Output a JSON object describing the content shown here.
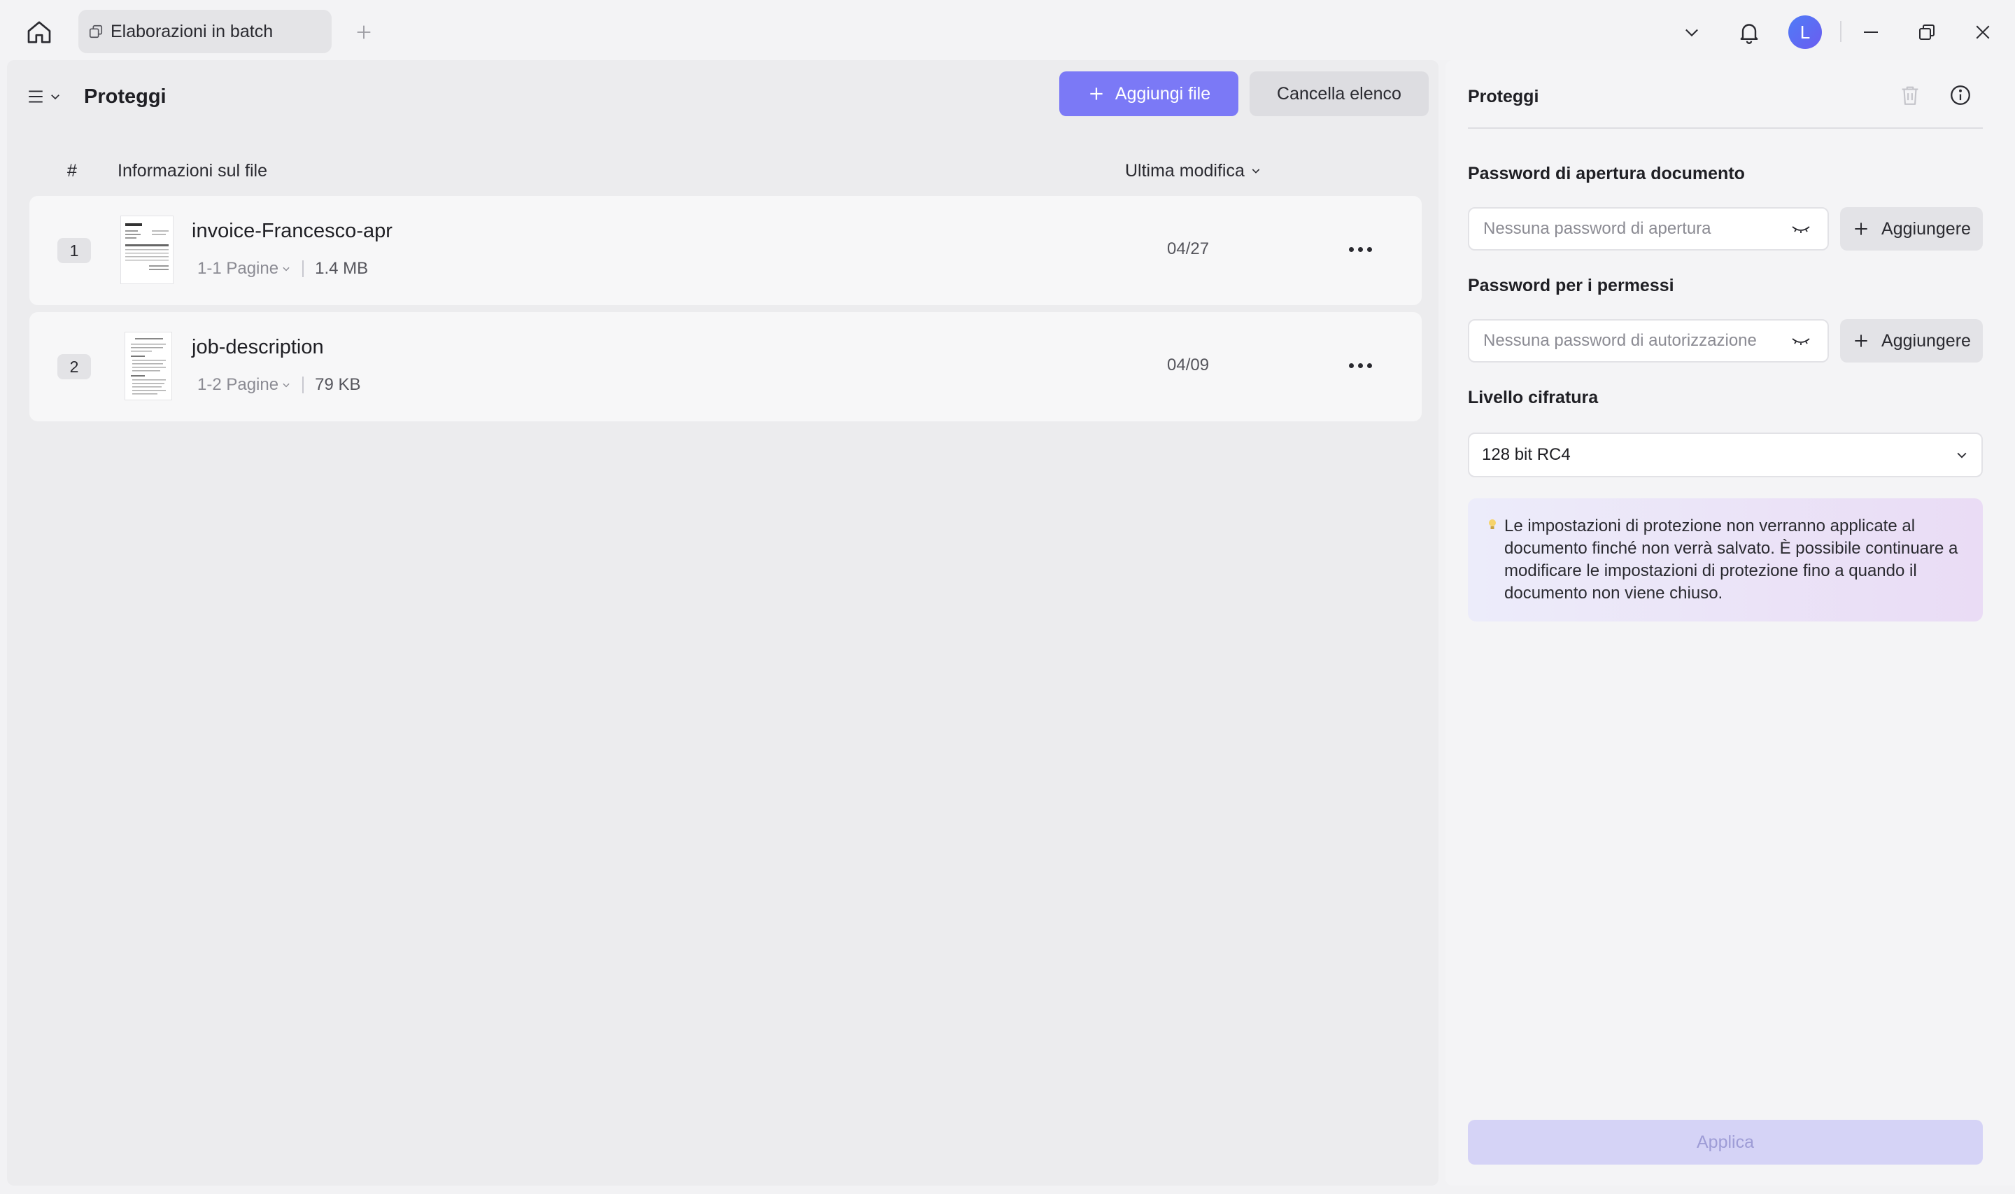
{
  "titlebar": {
    "tab_label": "Elaborazioni in batch",
    "avatar_initial": "L"
  },
  "main": {
    "title": "Proteggi",
    "add_files_label": "Aggiungi file",
    "clear_list_label": "Cancella elenco",
    "columns": {
      "number": "#",
      "file_info": "Informazioni sul file",
      "last_modified": "Ultima modifica"
    },
    "files": [
      {
        "index": "1",
        "name": "invoice-Francesco-apr",
        "pages": "1-1 Pagine",
        "size": "1.4 MB",
        "date": "04/27"
      },
      {
        "index": "2",
        "name": "job-description",
        "pages": "1-2 Pagine",
        "size": "79 KB",
        "date": "04/09"
      }
    ]
  },
  "panel": {
    "title": "Proteggi",
    "open_password_label": "Password di apertura documento",
    "open_password_placeholder": "Nessuna password di apertura",
    "open_password_add": "Aggiungere",
    "permissions_label": "Password per i permessi",
    "permissions_placeholder": "Nessuna password di autorizzazione",
    "permissions_add": "Aggiungere",
    "encryption_label": "Livello cifratura",
    "encryption_value": "128 bit RC4",
    "notice": "Le impostazioni di protezione non verranno applicate al documento finché non verrà salvato. È possibile continuare a modificare le impostazioni di protezione fino a quando il documento non viene chiuso.",
    "apply_label": "Applica"
  },
  "colors": {
    "accent": "#7b79f6",
    "apply_disabled": "#d5d3f6"
  }
}
